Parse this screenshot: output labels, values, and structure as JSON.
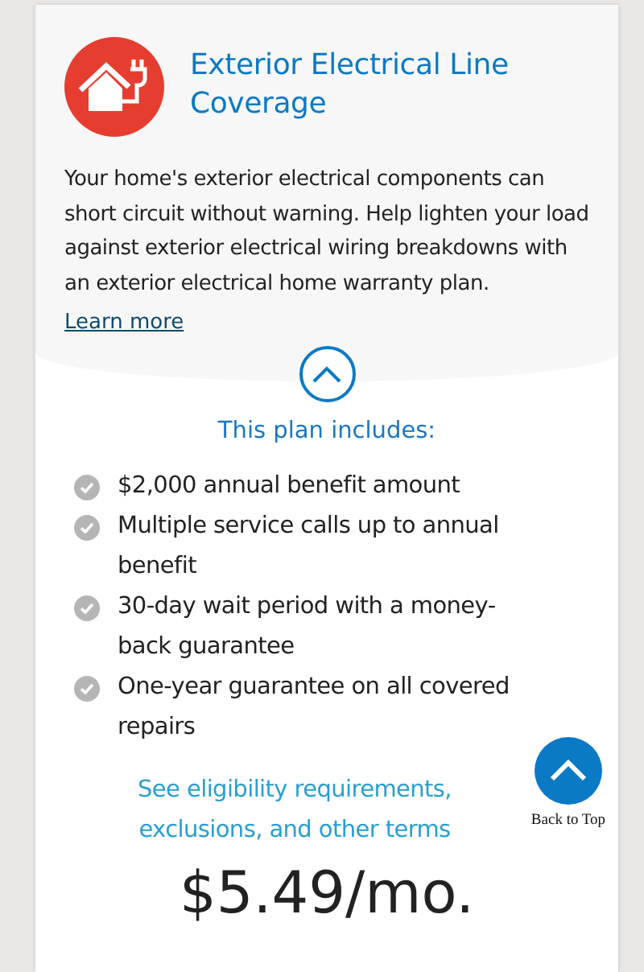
{
  "plan": {
    "title": "Exterior Electrical Line Coverage",
    "description": "Your home's exterior electrical components can short circuit without warning. Help lighten your load against exterior electrical wiring breakdowns with an exterior electrical home warranty plan.",
    "learn_more": "Learn more",
    "expanded": true,
    "includes_heading": "This plan includes:",
    "features": [
      {
        "text": "$2,000 annual benefit amount"
      },
      {
        "text": "Multiple service calls up to annual benefit"
      },
      {
        "text": "30-day wait period with a money-back guarantee"
      },
      {
        "text": "One-year guarantee on all covered repairs"
      }
    ],
    "terms_link": "See eligibility requirements, exclusions, and other terms",
    "price": "$5.49/mo."
  },
  "back_to_top": {
    "label": "Back to Top"
  }
}
